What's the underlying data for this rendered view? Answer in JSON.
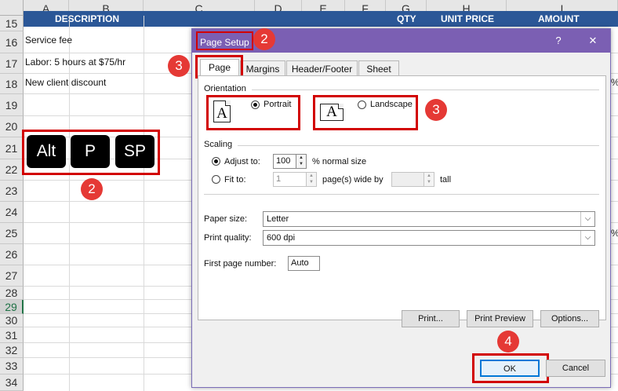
{
  "sheet": {
    "columns": [
      "A",
      "B",
      "C",
      "D",
      "E",
      "F",
      "G",
      "H",
      "I"
    ],
    "header_band": {
      "description": "DESCRIPTION",
      "qty": "QTY",
      "unit_price": "UNIT PRICE",
      "amount": "AMOUNT"
    },
    "rows": [
      "15",
      "16",
      "17",
      "18",
      "19",
      "20",
      "21",
      "22",
      "23",
      "24",
      "25",
      "26",
      "27",
      "28",
      "29",
      "30",
      "31",
      "32",
      "33",
      "34"
    ],
    "cells": {
      "r16": "Service fee",
      "r17": "Labor: 5 hours at $75/hr",
      "r18": "New client discount"
    },
    "edge_fragments": {
      "r18": "%)",
      "r25": "%"
    }
  },
  "shortcut": {
    "keys": [
      "Alt",
      "P",
      "SP"
    ],
    "step": "2"
  },
  "steps": {
    "title": "2",
    "tab": "3",
    "orientation": "3",
    "ok": "4"
  },
  "dialog": {
    "title": "Page Setup",
    "help": "?",
    "close": "✕",
    "tabs": [
      "Page",
      "Margins",
      "Header/Footer",
      "Sheet"
    ],
    "orientation": {
      "label": "Orientation",
      "portrait": "Portrait",
      "landscape": "Landscape",
      "glyph": "A",
      "selected": "portrait"
    },
    "scaling": {
      "label": "Scaling",
      "adjust_label": "Adjust to:",
      "adjust_value": "100",
      "adjust_suffix": "% normal size",
      "fit_label": "Fit to:",
      "fit_wide_value": "1",
      "fit_wide_suffix": "page(s) wide by",
      "fit_tall_value": "",
      "fit_tall_suffix": "tall"
    },
    "paper_size": {
      "label": "Paper size:",
      "value": "Letter"
    },
    "print_quality": {
      "label": "Print quality:",
      "value": "600 dpi"
    },
    "first_page": {
      "label": "First page number:",
      "value": "Auto"
    },
    "buttons": {
      "print": "Print...",
      "print_preview": "Print Preview",
      "options": "Options...",
      "ok": "OK",
      "cancel": "Cancel"
    }
  },
  "colors": {
    "band": "#2b5797",
    "titlebar": "#7b5fb3",
    "highlight": "#d20000",
    "step_badge": "#e53935",
    "ok_border": "#0078d7"
  }
}
